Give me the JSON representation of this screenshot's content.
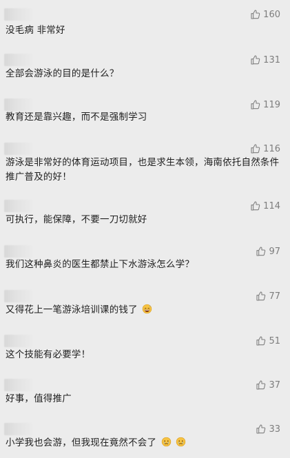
{
  "comments": [
    {
      "likes": "160",
      "text": "没毛病 非常好"
    },
    {
      "likes": "131",
      "text": "全部会游泳的目的是什么？"
    },
    {
      "likes": "119",
      "text": "教育还是靠兴趣，而不是强制学习"
    },
    {
      "likes": "116",
      "text": "游泳是非常好的体育运动项目，也是求生本领，海南依托自然条件推广普及的好！"
    },
    {
      "likes": "114",
      "text": "可执行，能保障，不要一刀切就好"
    },
    {
      "likes": "97",
      "text": "我们这种鼻炎的医生都禁止下水游泳怎么学？"
    },
    {
      "likes": "77",
      "text": "又得花上一笔游泳培训课的钱了"
    },
    {
      "likes": "51",
      "text": "这个技能有必要学！"
    },
    {
      "likes": "37",
      "text": "好事，值得推广"
    },
    {
      "likes": "33",
      "text": "小学我也会游，但我现在竟然不会了"
    }
  ],
  "icons": {
    "like": "thumbs-up-outline",
    "emoji_money": "grinning-sweat-face",
    "emoji_cry": "crying-face"
  },
  "colors": {
    "background": "#ececec",
    "text": "#1f1f1f",
    "meta": "#7d7d7d"
  }
}
